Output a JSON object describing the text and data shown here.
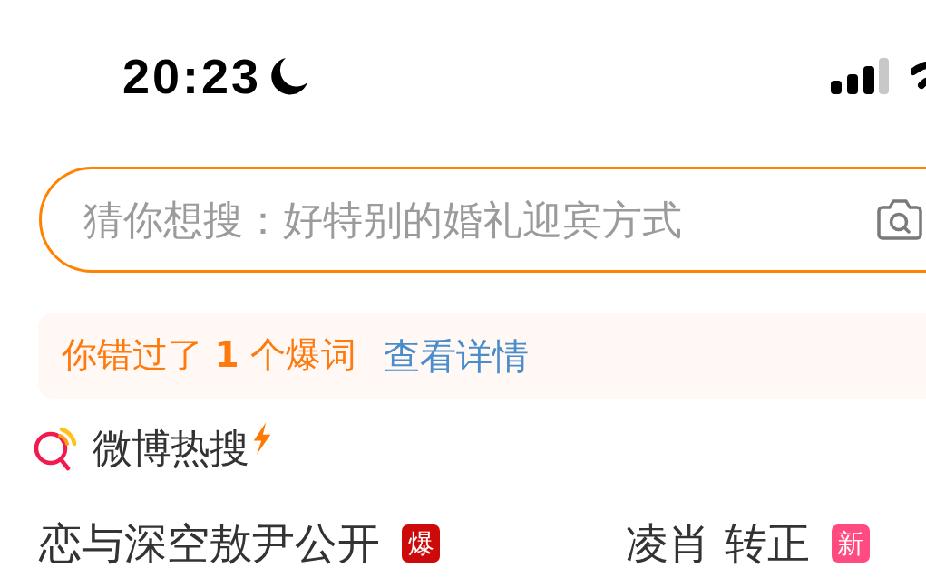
{
  "status_bar": {
    "time": "20:23",
    "do_not_disturb": true
  },
  "search": {
    "placeholder": "猜你想搜：好特别的婚礼迎宾方式"
  },
  "banner": {
    "message": "你错过了 **1** 个爆词",
    "link": "查看详情"
  },
  "hot_search": {
    "title": "微博热搜",
    "items": [
      {
        "title": "恋与深空敖尹公开",
        "badge": "爆",
        "color": "#cc0a0a"
      },
      {
        "title": "凌肖 转正",
        "badge": "新",
        "color": "#ff4b80"
      }
    ]
  }
}
